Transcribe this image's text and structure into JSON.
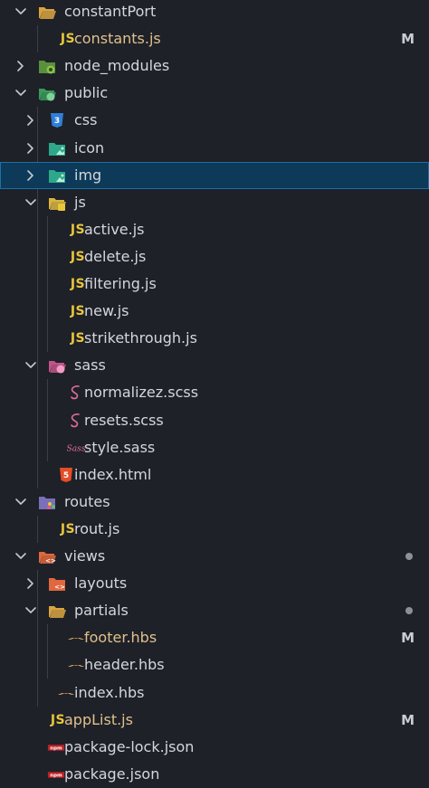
{
  "colors": {
    "background": "#1e2128",
    "selected_bg": "#0d3a59",
    "modified_text": "#e2c08d",
    "js_yellow": "#e8c53b",
    "sass_pink": "#e06c9f",
    "html_orange": "#e44d26",
    "css_blue": "#2f7fd8"
  },
  "explorer": {
    "items": [
      {
        "label": "constantPort",
        "icon": "folder-open-icon",
        "status": ""
      },
      {
        "label": "constants.js",
        "icon": "javascript-icon",
        "status": "M"
      },
      {
        "label": "node_modules",
        "icon": "node-folder-icon",
        "status": ""
      },
      {
        "label": "public",
        "icon": "public-folder-open-icon",
        "status": ""
      },
      {
        "label": "css",
        "icon": "css-folder-icon",
        "status": ""
      },
      {
        "label": "icon",
        "icon": "image-folder-icon",
        "status": ""
      },
      {
        "label": "img",
        "icon": "image-folder-icon",
        "status": ""
      },
      {
        "label": "js",
        "icon": "js-folder-open-icon",
        "status": ""
      },
      {
        "label": "active.js",
        "icon": "javascript-icon",
        "status": ""
      },
      {
        "label": "delete.js",
        "icon": "javascript-icon",
        "status": ""
      },
      {
        "label": "filtering.js",
        "icon": "javascript-icon",
        "status": ""
      },
      {
        "label": "new.js",
        "icon": "javascript-icon",
        "status": ""
      },
      {
        "label": "strikethrough.js",
        "icon": "javascript-icon",
        "status": ""
      },
      {
        "label": "sass",
        "icon": "sass-folder-open-icon",
        "status": ""
      },
      {
        "label": "normalizez.scss",
        "icon": "scss-icon",
        "status": ""
      },
      {
        "label": "resets.scss",
        "icon": "scss-icon",
        "status": ""
      },
      {
        "label": "style.sass",
        "icon": "sass-icon",
        "status": ""
      },
      {
        "label": "index.html",
        "icon": "html-icon",
        "status": ""
      },
      {
        "label": "routes",
        "icon": "routes-folder-icon",
        "status": ""
      },
      {
        "label": "rout.js",
        "icon": "javascript-icon",
        "status": ""
      },
      {
        "label": "views",
        "icon": "views-folder-open-icon",
        "status": "dot"
      },
      {
        "label": "layouts",
        "icon": "views-folder-icon",
        "status": ""
      },
      {
        "label": "partials",
        "icon": "folder-open-icon",
        "status": "dot"
      },
      {
        "label": "footer.hbs",
        "icon": "handlebars-icon",
        "status": "M"
      },
      {
        "label": "header.hbs",
        "icon": "handlebars-icon",
        "status": ""
      },
      {
        "label": "index.hbs",
        "icon": "handlebars-icon",
        "status": ""
      },
      {
        "label": "appList.js",
        "icon": "javascript-icon",
        "status": "M"
      },
      {
        "label": "package-lock.json",
        "icon": "npm-icon",
        "status": ""
      },
      {
        "label": "package.json",
        "icon": "npm-icon",
        "status": ""
      }
    ]
  }
}
